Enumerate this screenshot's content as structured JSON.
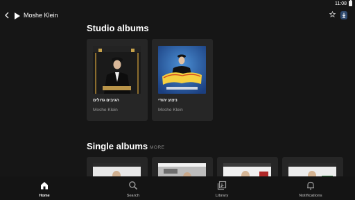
{
  "status_bar": {
    "time": "11:08"
  },
  "header": {
    "title": "Moshe Klein"
  },
  "studio_albums": {
    "title": "Studio albums",
    "items": [
      {
        "title": "הגיבים גדולים",
        "artist": "Moshe Klein"
      },
      {
        "title": "ניצוץ יהודי",
        "artist": "Moshe Klein"
      }
    ]
  },
  "single_albums": {
    "title": "Single albums",
    "more_label": "MORE"
  },
  "bottom_nav": {
    "items": [
      {
        "label": "Home",
        "icon": "home-icon",
        "active": true
      },
      {
        "label": "Search",
        "icon": "search-icon",
        "active": false
      },
      {
        "label": "Library",
        "icon": "library-icon",
        "active": false
      },
      {
        "label": "Notifications",
        "icon": "bell-icon",
        "active": false
      }
    ]
  },
  "colors": {
    "background": "#161616",
    "card": "#262626",
    "accent_blue": "#2f4a6e"
  }
}
